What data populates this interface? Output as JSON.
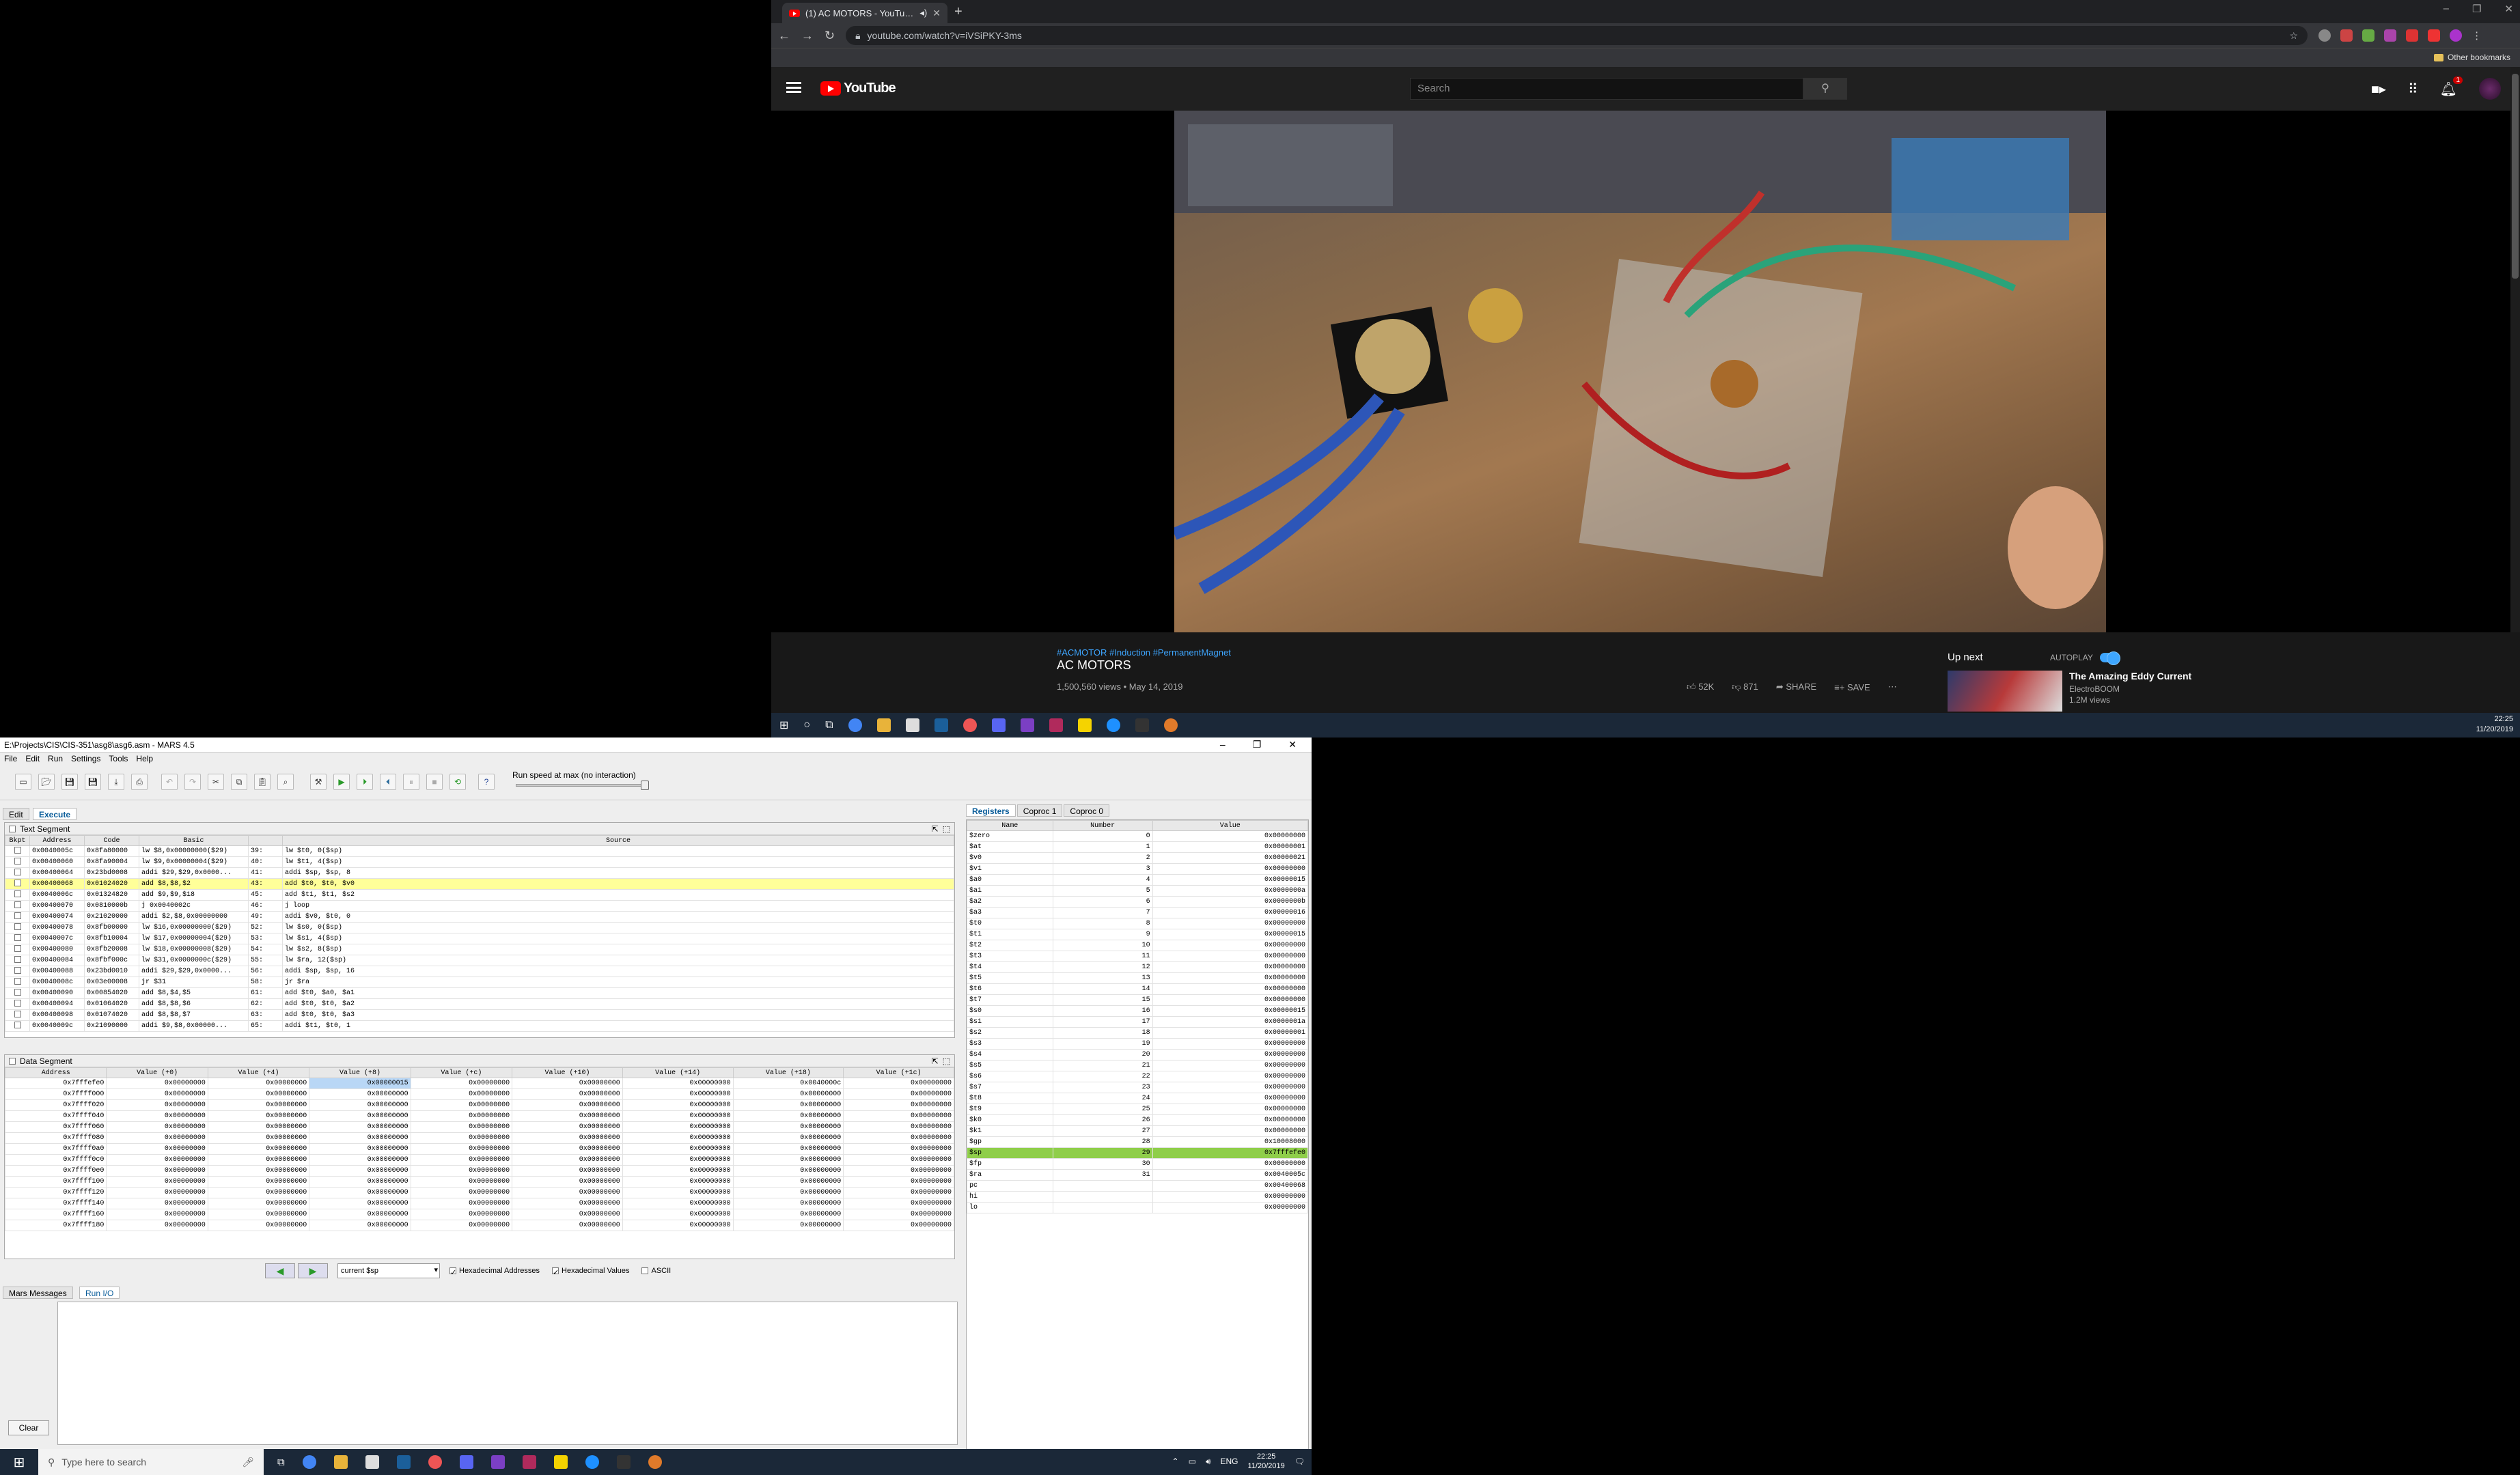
{
  "browser": {
    "tab_title": "(1) AC MOTORS - YouTube",
    "new_tab": "+",
    "url": "youtube.com/watch?v=iVSiPKY-3ms",
    "other_bookmarks": "Other bookmarks"
  },
  "youtube": {
    "logo_text": "YouTube",
    "search_placeholder": "Search",
    "notification_count": "1",
    "tags": "#ACMOTOR #Induction #PermanentMagnet",
    "title": "AC MOTORS",
    "views": "1,500,560 views • May 14, 2019",
    "likes": "52K",
    "dislikes": "871",
    "share": "SHARE",
    "save": "SAVE",
    "up_next": "Up next",
    "autoplay": "AUTOPLAY",
    "next_title": "The Amazing Eddy Current",
    "next_channel": "ElectroBOOM",
    "next_views": "1.2M views"
  },
  "taskbar_top": {
    "time": "22:25",
    "date": "11/20/2019"
  },
  "mars": {
    "title": "E:\\Projects\\CIS\\CIS-351\\asg8\\asg6.asm - MARS 4.5",
    "menu": [
      "File",
      "Edit",
      "Run",
      "Settings",
      "Tools",
      "Help"
    ],
    "run_speed": "Run speed at max (no interaction)",
    "tabs": {
      "edit": "Edit",
      "execute": "Execute"
    },
    "text_segment": {
      "title": "Text Segment",
      "columns": [
        "Bkpt",
        "Address",
        "Code",
        "Basic",
        "Source"
      ],
      "rows": [
        [
          "0x0040005c",
          "0x8fa80000",
          "lw $8,0x00000000($29)",
          "39:",
          "lw $t0, 0($sp)"
        ],
        [
          "0x00400060",
          "0x8fa90004",
          "lw $9,0x00000004($29)",
          "40:",
          "lw $t1, 4($sp)"
        ],
        [
          "0x00400064",
          "0x23bd0008",
          "addi $29,$29,0x0000...",
          "41:",
          "addi $sp, $sp, 8"
        ],
        [
          "0x00400068",
          "0x01024020",
          "add $8,$8,$2",
          "43:",
          "add $t0, $t0, $v0"
        ],
        [
          "0x0040006c",
          "0x01324820",
          "add $9,$9,$18",
          "45:",
          "add $t1, $t1, $s2"
        ],
        [
          "0x00400070",
          "0x0810000b",
          "j 0x0040002c",
          "46:",
          "j loop"
        ],
        [
          "0x00400074",
          "0x21020000",
          "addi $2,$8,0x00000000",
          "49:",
          "addi $v0, $t0, 0"
        ],
        [
          "0x00400078",
          "0x8fb00000",
          "lw $16,0x00000000($29)",
          "52:",
          "lw $s0, 0($sp)"
        ],
        [
          "0x0040007c",
          "0x8fb10004",
          "lw $17,0x00000004($29)",
          "53:",
          "lw $s1, 4($sp)"
        ],
        [
          "0x00400080",
          "0x8fb20008",
          "lw $18,0x00000008($29)",
          "54:",
          "lw $s2, 8($sp)"
        ],
        [
          "0x00400084",
          "0x8fbf000c",
          "lw $31,0x0000000c($29)",
          "55:",
          "lw $ra, 12($sp)"
        ],
        [
          "0x00400088",
          "0x23bd0010",
          "addi $29,$29,0x0000...",
          "56:",
          "addi $sp, $sp, 16"
        ],
        [
          "0x0040008c",
          "0x03e00008",
          "jr $31",
          "58:",
          "jr $ra"
        ],
        [
          "0x00400090",
          "0x00854020",
          "add $8,$4,$5",
          "61:",
          "add $t0, $a0, $a1"
        ],
        [
          "0x00400094",
          "0x01064020",
          "add $8,$8,$6",
          "62:",
          "add $t0, $t0, $a2"
        ],
        [
          "0x00400098",
          "0x01074020",
          "add $8,$8,$7",
          "63:",
          "add $t0, $t0, $a3"
        ],
        [
          "0x0040009c",
          "0x21090000",
          "addi $9,$8,0x00000...",
          "65:",
          "addi $t1, $t0, 1"
        ]
      ]
    },
    "data_segment": {
      "title": "Data Segment",
      "columns": [
        "Address",
        "Value (+0)",
        "Value (+4)",
        "Value (+8)",
        "Value (+c)",
        "Value (+10)",
        "Value (+14)",
        "Value (+18)",
        "Value (+1c)"
      ],
      "rows": [
        [
          "0x7fffefe0",
          "0x00000000",
          "0x00000000",
          "0x00000015",
          "0x00000000",
          "0x00000000",
          "0x00000000",
          "0x0040000c",
          "0x00000000"
        ],
        [
          "0x7ffff000",
          "0x00000000",
          "0x00000000",
          "0x00000000",
          "0x00000000",
          "0x00000000",
          "0x00000000",
          "0x00000000",
          "0x00000000"
        ],
        [
          "0x7ffff020",
          "0x00000000",
          "0x00000000",
          "0x00000000",
          "0x00000000",
          "0x00000000",
          "0x00000000",
          "0x00000000",
          "0x00000000"
        ],
        [
          "0x7ffff040",
          "0x00000000",
          "0x00000000",
          "0x00000000",
          "0x00000000",
          "0x00000000",
          "0x00000000",
          "0x00000000",
          "0x00000000"
        ],
        [
          "0x7ffff060",
          "0x00000000",
          "0x00000000",
          "0x00000000",
          "0x00000000",
          "0x00000000",
          "0x00000000",
          "0x00000000",
          "0x00000000"
        ],
        [
          "0x7ffff080",
          "0x00000000",
          "0x00000000",
          "0x00000000",
          "0x00000000",
          "0x00000000",
          "0x00000000",
          "0x00000000",
          "0x00000000"
        ],
        [
          "0x7ffff0a0",
          "0x00000000",
          "0x00000000",
          "0x00000000",
          "0x00000000",
          "0x00000000",
          "0x00000000",
          "0x00000000",
          "0x00000000"
        ],
        [
          "0x7ffff0c0",
          "0x00000000",
          "0x00000000",
          "0x00000000",
          "0x00000000",
          "0x00000000",
          "0x00000000",
          "0x00000000",
          "0x00000000"
        ],
        [
          "0x7ffff0e0",
          "0x00000000",
          "0x00000000",
          "0x00000000",
          "0x00000000",
          "0x00000000",
          "0x00000000",
          "0x00000000",
          "0x00000000"
        ],
        [
          "0x7ffff100",
          "0x00000000",
          "0x00000000",
          "0x00000000",
          "0x00000000",
          "0x00000000",
          "0x00000000",
          "0x00000000",
          "0x00000000"
        ],
        [
          "0x7ffff120",
          "0x00000000",
          "0x00000000",
          "0x00000000",
          "0x00000000",
          "0x00000000",
          "0x00000000",
          "0x00000000",
          "0x00000000"
        ],
        [
          "0x7ffff140",
          "0x00000000",
          "0x00000000",
          "0x00000000",
          "0x00000000",
          "0x00000000",
          "0x00000000",
          "0x00000000",
          "0x00000000"
        ],
        [
          "0x7ffff160",
          "0x00000000",
          "0x00000000",
          "0x00000000",
          "0x00000000",
          "0x00000000",
          "0x00000000",
          "0x00000000",
          "0x00000000"
        ],
        [
          "0x7ffff180",
          "0x00000000",
          "0x00000000",
          "0x00000000",
          "0x00000000",
          "0x00000000",
          "0x00000000",
          "0x00000000",
          "0x00000000"
        ]
      ],
      "combo": "current $sp",
      "hex_addresses": "Hexadecimal Addresses",
      "hex_values": "Hexadecimal Values",
      "ascii": "ASCII"
    },
    "registers": {
      "tabs": [
        "Registers",
        "Coproc 1",
        "Coproc 0"
      ],
      "columns": [
        "Name",
        "Number",
        "Value"
      ],
      "rows": [
        [
          "$zero",
          "0",
          "0x00000000"
        ],
        [
          "$at",
          "1",
          "0x00000001"
        ],
        [
          "$v0",
          "2",
          "0x00000021"
        ],
        [
          "$v1",
          "3",
          "0x00000000"
        ],
        [
          "$a0",
          "4",
          "0x00000015"
        ],
        [
          "$a1",
          "5",
          "0x0000000a"
        ],
        [
          "$a2",
          "6",
          "0x0000000b"
        ],
        [
          "$a3",
          "7",
          "0x00000016"
        ],
        [
          "$t0",
          "8",
          "0x00000000"
        ],
        [
          "$t1",
          "9",
          "0x00000015"
        ],
        [
          "$t2",
          "10",
          "0x00000000"
        ],
        [
          "$t3",
          "11",
          "0x00000000"
        ],
        [
          "$t4",
          "12",
          "0x00000000"
        ],
        [
          "$t5",
          "13",
          "0x00000000"
        ],
        [
          "$t6",
          "14",
          "0x00000000"
        ],
        [
          "$t7",
          "15",
          "0x00000000"
        ],
        [
          "$s0",
          "16",
          "0x00000015"
        ],
        [
          "$s1",
          "17",
          "0x0000001a"
        ],
        [
          "$s2",
          "18",
          "0x00000001"
        ],
        [
          "$s3",
          "19",
          "0x00000000"
        ],
        [
          "$s4",
          "20",
          "0x00000000"
        ],
        [
          "$s5",
          "21",
          "0x00000000"
        ],
        [
          "$s6",
          "22",
          "0x00000000"
        ],
        [
          "$s7",
          "23",
          "0x00000000"
        ],
        [
          "$t8",
          "24",
          "0x00000000"
        ],
        [
          "$t9",
          "25",
          "0x00000000"
        ],
        [
          "$k0",
          "26",
          "0x00000000"
        ],
        [
          "$k1",
          "27",
          "0x00000000"
        ],
        [
          "$gp",
          "28",
          "0x10008000"
        ],
        [
          "$sp",
          "29",
          "0x7fffefe0"
        ],
        [
          "$fp",
          "30",
          "0x00000000"
        ],
        [
          "$ra",
          "31",
          "0x0040005c"
        ],
        [
          "pc",
          "",
          "0x00400068"
        ],
        [
          "hi",
          "",
          "0x00000000"
        ],
        [
          "lo",
          "",
          "0x00000000"
        ]
      ]
    },
    "messages": {
      "tab1": "Mars Messages",
      "tab2": "Run I/O",
      "clear": "Clear"
    }
  },
  "taskbar_bottom": {
    "search_placeholder": "Type here to search",
    "lang": "ENG",
    "time": "22:25",
    "date": "11/20/2019"
  }
}
